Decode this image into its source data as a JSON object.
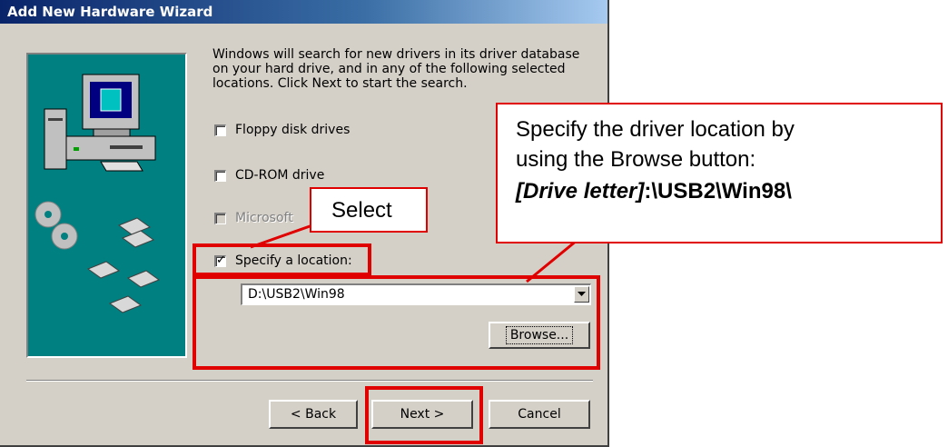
{
  "window": {
    "title": "Add New Hardware Wizard"
  },
  "intro_text": "Windows will search for new drivers in its driver database on your hard drive, and in any of the following selected locations. Click Next to start the search.",
  "options": [
    {
      "label": "Floppy disk drives",
      "checked": false,
      "enabled": true
    },
    {
      "label": "CD-ROM drive",
      "checked": false,
      "enabled": true
    },
    {
      "label": "Microsoft",
      "checked": false,
      "enabled": false
    },
    {
      "label": "Specify a location:",
      "checked": true,
      "enabled": true
    }
  ],
  "location": {
    "value": "D:\\USB2\\Win98"
  },
  "buttons": {
    "browse": "Browse...",
    "back": "< Back",
    "next": "Next >",
    "cancel": "Cancel"
  },
  "annotations": {
    "select": "Select",
    "drive_line1": "Specify the driver location by",
    "drive_line2": "using the Browse button:",
    "drive_line3_italic": "[Drive letter]",
    "drive_line3_rest": ":\\USB2\\Win98\\"
  },
  "colors": {
    "highlight": "#e00000",
    "titlebar": "#0a246a",
    "dialog": "#d4d0c8",
    "art_bg": "#008080"
  }
}
